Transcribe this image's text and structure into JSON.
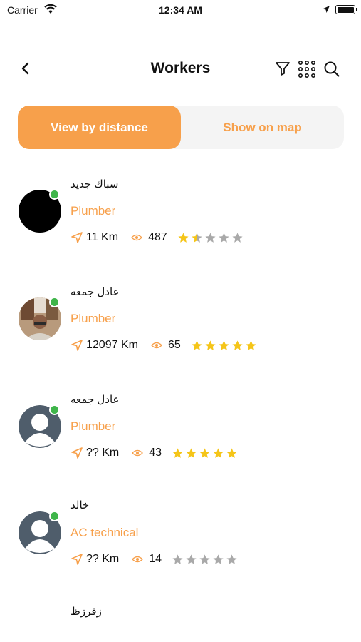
{
  "status_bar": {
    "carrier": "Carrier",
    "time": "12:34 AM"
  },
  "header": {
    "title": "Workers"
  },
  "tabs": [
    {
      "label": "View by distance",
      "active": true
    },
    {
      "label": "Show on map",
      "active": false
    }
  ],
  "workers": [
    {
      "name": "سباك جديد",
      "job": "Plumber",
      "distance": "11 Km",
      "views": "487",
      "rating": 1.5,
      "avatar": "black"
    },
    {
      "name": "عادل جمعه",
      "job": "Plumber",
      "distance": "12097 Km",
      "views": "65",
      "rating": 5,
      "avatar": "photo"
    },
    {
      "name": "عادل جمعه",
      "job": "Plumber",
      "distance": "?? Km",
      "views": "43",
      "rating": 5,
      "avatar": "placeholder"
    },
    {
      "name": "خالد",
      "job": "AC technical",
      "distance": "?? Km",
      "views": "14",
      "rating": 0,
      "avatar": "placeholder"
    },
    {
      "name": "زفرزظ"
    }
  ],
  "colors": {
    "accent": "#f7a04b",
    "online": "#3fb54a",
    "star_filled": "#f5c518",
    "star_empty": "#a9a9a9"
  },
  "icons": [
    "wifi-icon",
    "location-arrow-icon",
    "battery-icon",
    "back-arrow-icon",
    "filter-icon",
    "grid-icon",
    "search-icon",
    "navigation-icon",
    "eye-icon",
    "star-icon"
  ]
}
